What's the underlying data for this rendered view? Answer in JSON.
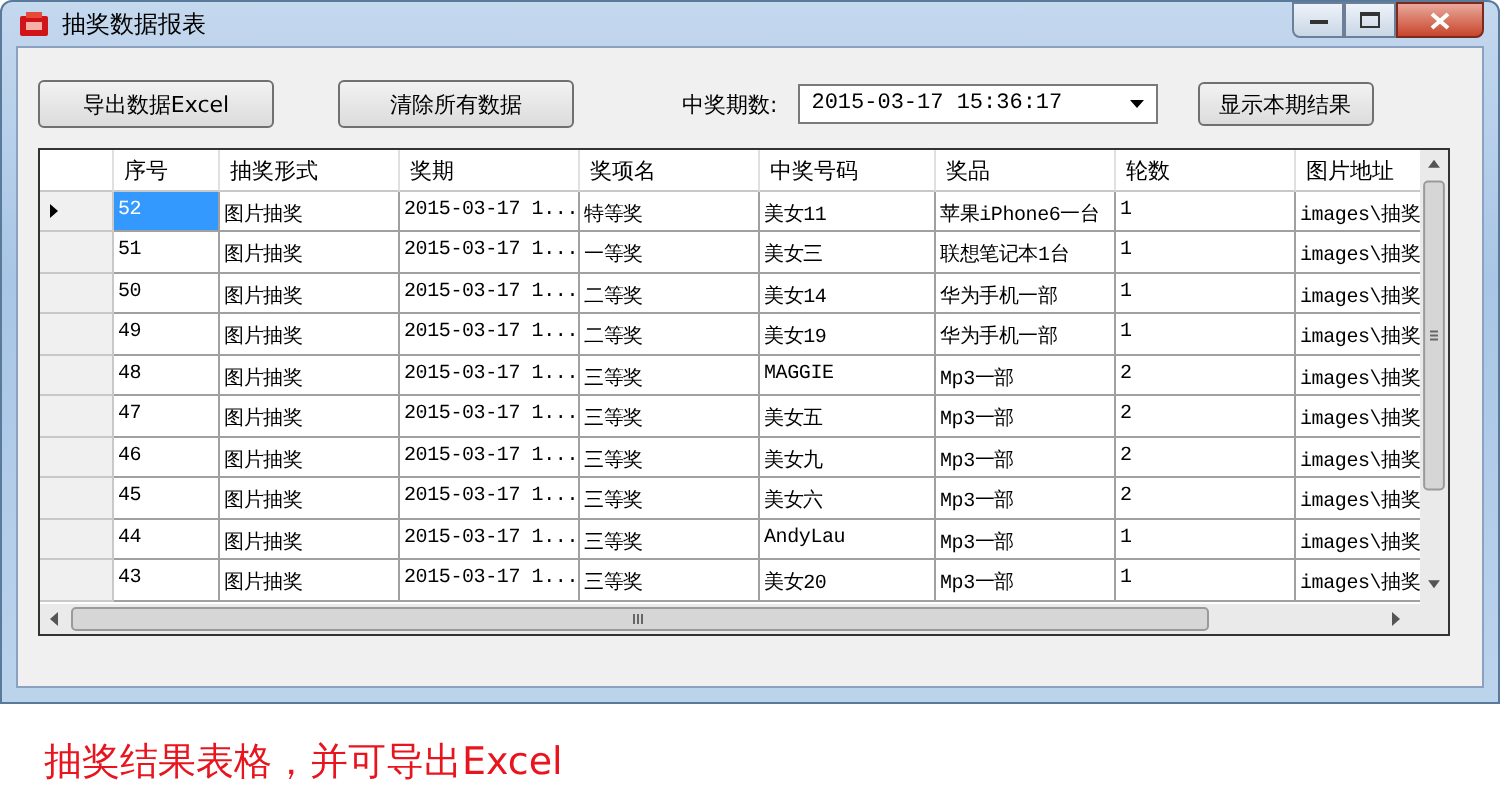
{
  "window": {
    "title": "抽奖数据报表"
  },
  "toolbar": {
    "export_button": "导出数据Excel",
    "clear_button": "清除所有数据",
    "period_label": "中奖期数:",
    "period_value": "2015-03-17 15:36:17",
    "show_button": "显示本期结果"
  },
  "table": {
    "columns": [
      "序号",
      "抽奖形式",
      "奖期",
      "奖项名",
      "中奖号码",
      "奖品",
      "轮数",
      "图片地址"
    ],
    "rows": [
      {
        "selected": true,
        "cells": [
          "52",
          "图片抽奖",
          "2015-03-17 1...",
          "特等奖",
          "美女11",
          "苹果iPhone6一台",
          "1",
          "images\\抽奖"
        ]
      },
      {
        "selected": false,
        "cells": [
          "51",
          "图片抽奖",
          "2015-03-17 1...",
          "一等奖",
          "美女三",
          "联想笔记本1台",
          "1",
          "images\\抽奖"
        ]
      },
      {
        "selected": false,
        "cells": [
          "50",
          "图片抽奖",
          "2015-03-17 1...",
          "二等奖",
          "美女14",
          "华为手机一部",
          "1",
          "images\\抽奖"
        ]
      },
      {
        "selected": false,
        "cells": [
          "49",
          "图片抽奖",
          "2015-03-17 1...",
          "二等奖",
          "美女19",
          "华为手机一部",
          "1",
          "images\\抽奖"
        ]
      },
      {
        "selected": false,
        "cells": [
          "48",
          "图片抽奖",
          "2015-03-17 1...",
          "三等奖",
          "MAGGIE",
          "Mp3一部",
          "2",
          "images\\抽奖"
        ]
      },
      {
        "selected": false,
        "cells": [
          "47",
          "图片抽奖",
          "2015-03-17 1...",
          "三等奖",
          "美女五",
          "Mp3一部",
          "2",
          "images\\抽奖"
        ]
      },
      {
        "selected": false,
        "cells": [
          "46",
          "图片抽奖",
          "2015-03-17 1...",
          "三等奖",
          "美女九",
          "Mp3一部",
          "2",
          "images\\抽奖"
        ]
      },
      {
        "selected": false,
        "cells": [
          "45",
          "图片抽奖",
          "2015-03-17 1...",
          "三等奖",
          "美女六",
          "Mp3一部",
          "2",
          "images\\抽奖"
        ]
      },
      {
        "selected": false,
        "cells": [
          "44",
          "图片抽奖",
          "2015-03-17 1...",
          "三等奖",
          "AndyLau",
          "Mp3一部",
          "1",
          "images\\抽奖"
        ]
      },
      {
        "selected": false,
        "cells": [
          "43",
          "图片抽奖",
          "2015-03-17 1...",
          "三等奖",
          "美女20",
          "Mp3一部",
          "1",
          "images\\抽奖"
        ]
      }
    ]
  },
  "caption": "抽奖结果表格，并可导出Excel"
}
